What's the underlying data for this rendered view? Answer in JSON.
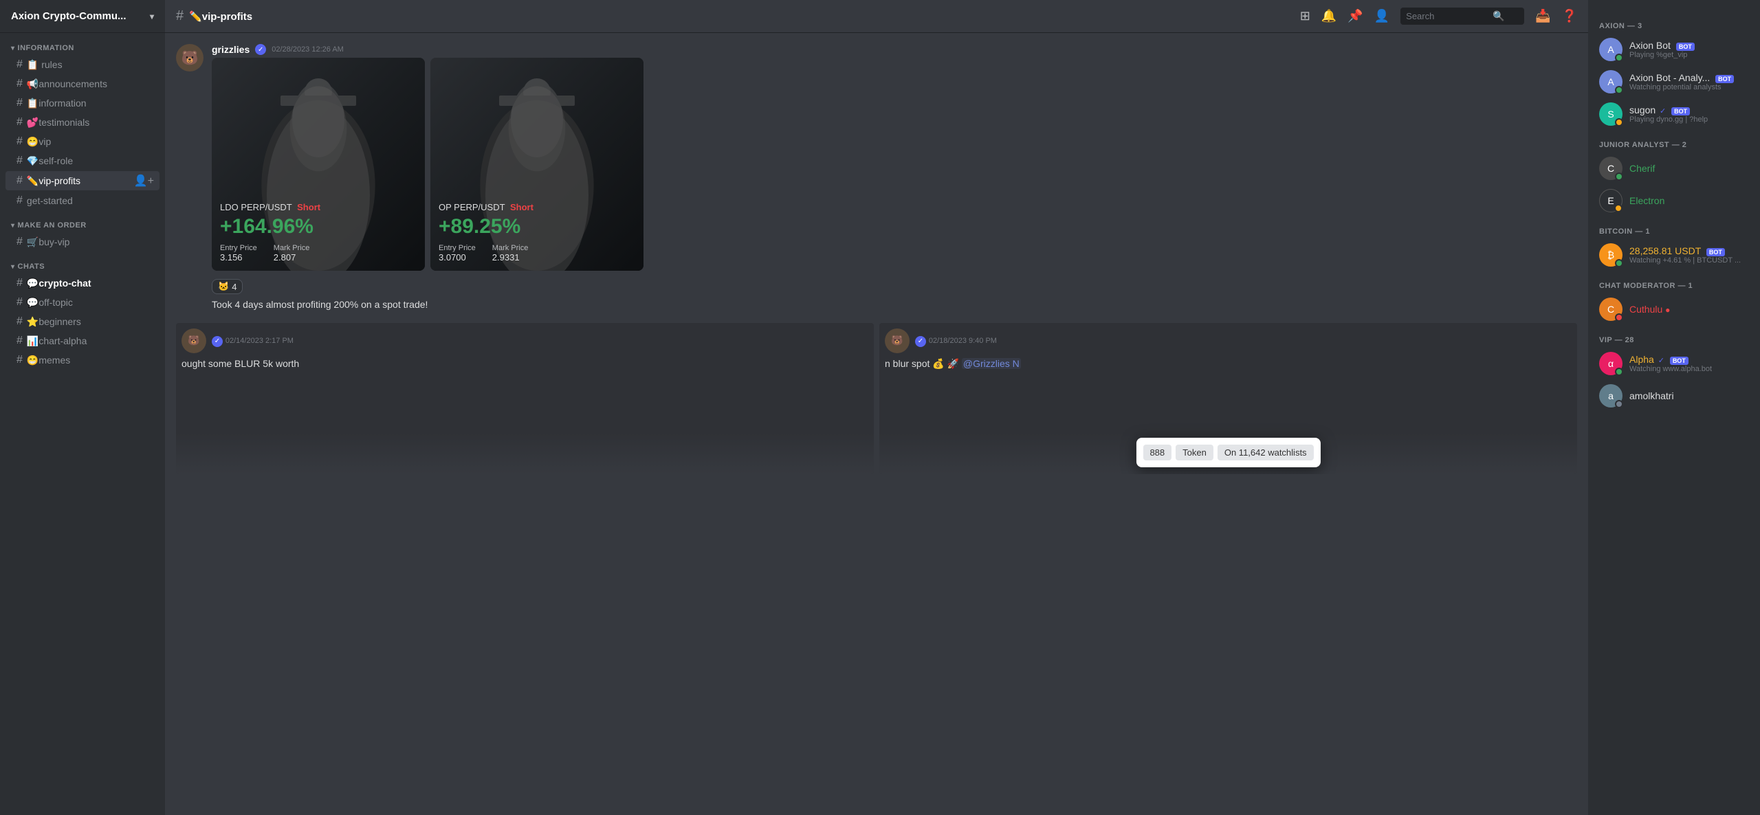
{
  "server": {
    "name": "Axion Crypto-Commu...",
    "icon": "A"
  },
  "channel": {
    "name": "vip-profits",
    "prefix": "#",
    "slash": "✏️"
  },
  "header": {
    "search_placeholder": "Search"
  },
  "sidebar": {
    "sections": [
      {
        "label": "INFORMATION",
        "channels": [
          {
            "name": "rules",
            "icon": "📋",
            "hash": true
          },
          {
            "name": "📢announcements",
            "icon": "",
            "hash": true
          },
          {
            "name": "📋information",
            "icon": "",
            "hash": true
          },
          {
            "name": "💕testimonials",
            "icon": "",
            "hash": true
          },
          {
            "name": "😁vip",
            "icon": "",
            "hash": true
          },
          {
            "name": "💎self-role",
            "icon": "",
            "hash": true
          },
          {
            "name": "✏️vip-profits",
            "icon": "",
            "hash": true,
            "active": true
          },
          {
            "name": "get-started",
            "icon": "",
            "hash": true
          }
        ]
      },
      {
        "label": "MAKE AN ORDER",
        "channels": [
          {
            "name": "🛒buy-vip",
            "icon": "",
            "hash": true
          }
        ]
      },
      {
        "label": "CHATS",
        "channels": [
          {
            "name": "💬crypto-chat",
            "icon": "",
            "hash": true,
            "bold": true
          },
          {
            "name": "💬off-topic",
            "icon": "",
            "hash": true
          },
          {
            "name": "⭐beginners",
            "icon": "",
            "hash": true
          },
          {
            "name": "📊chart-alpha",
            "icon": "",
            "hash": true
          },
          {
            "name": "😁memes",
            "icon": "",
            "hash": true
          }
        ]
      }
    ]
  },
  "messages": [
    {
      "id": "msg1",
      "username": "grizzlies",
      "verified": true,
      "timestamp": "02/28/2023 12:26 AM",
      "reaction_emoji": "🐱",
      "reaction_count": "4",
      "caption": "Took 4 days almost profiting 200% on a spot trade!",
      "trades": [
        {
          "pair": "LDO PERP/USDT",
          "direction": "Short",
          "percent": "+164.96%",
          "entry_label": "Entry Price",
          "entry_val": "3.156",
          "mark_label": "Mark Price",
          "mark_val": "2.807"
        },
        {
          "pair": "OP PERP/USDT",
          "direction": "Short",
          "percent": "+89.25%",
          "entry_label": "Entry Price",
          "entry_val": "3.0700",
          "mark_label": "Mark Price",
          "mark_val": "2.9331"
        }
      ]
    },
    {
      "id": "msg2",
      "partial": true,
      "timestamp1": "02/14/2023 2:17 PM",
      "text1": "ought some BLUR 5k worth",
      "timestamp2": "02/18/2023 9:40 PM",
      "text2": "n blur spot 💰 🚀 @Grizzlies N"
    }
  ],
  "popup": {
    "tags": [
      "888",
      "Token",
      "On 11,642 watchlists"
    ]
  },
  "members": {
    "groups": [
      {
        "label": "AXION — 3",
        "members": [
          {
            "name": "Axion Bot",
            "bot": true,
            "status": "online",
            "activity": "Playing %get_vip",
            "avatar_color": "#7289da",
            "avatar_text": "A"
          },
          {
            "name": "Axion Bot - Analy...",
            "bot": true,
            "status": "online",
            "activity": "Watching potential analysts",
            "avatar_color": "#7289da",
            "avatar_text": "A"
          },
          {
            "name": "sugon",
            "verified": true,
            "bot": true,
            "status": "idle",
            "activity": "Playing dyno.gg | ?help",
            "avatar_color": "#1abc9c",
            "avatar_text": "S"
          }
        ]
      },
      {
        "label": "JUNIOR ANALYST — 2",
        "members": [
          {
            "name": "Cherif",
            "status": "online",
            "activity": "",
            "avatar_color": "#4f4f4f",
            "avatar_text": "C",
            "name_color": "green"
          },
          {
            "name": "Electron",
            "status": "idle",
            "activity": "",
            "avatar_color": "#2c2f33",
            "avatar_text": "E",
            "name_color": "green"
          }
        ]
      },
      {
        "label": "BITCOIN — 1",
        "members": [
          {
            "name": "28,258.81 USDT",
            "bot": true,
            "status": "online",
            "activity": "Watching +4.61 % | BTCUSDT ...",
            "avatar_color": "#f7931a",
            "avatar_text": "₿",
            "name_color": "gold"
          }
        ]
      },
      {
        "label": "CHAT MODERATOR — 1",
        "members": [
          {
            "name": "Cuthulu",
            "status": "red",
            "activity": "",
            "avatar_color": "#e67e22",
            "avatar_text": "C",
            "name_color": "red-name"
          }
        ]
      },
      {
        "label": "VIP — 28",
        "members": [
          {
            "name": "Alpha",
            "verified": true,
            "bot": true,
            "status": "online",
            "activity": "Watching www.alpha.bot",
            "avatar_color": "#e91e63",
            "avatar_text": "α",
            "name_color": "gold"
          },
          {
            "name": "amolkhatri",
            "status": "offline",
            "activity": "",
            "avatar_color": "#607d8b",
            "avatar_text": "a",
            "name_color": "normal"
          }
        ]
      }
    ]
  }
}
